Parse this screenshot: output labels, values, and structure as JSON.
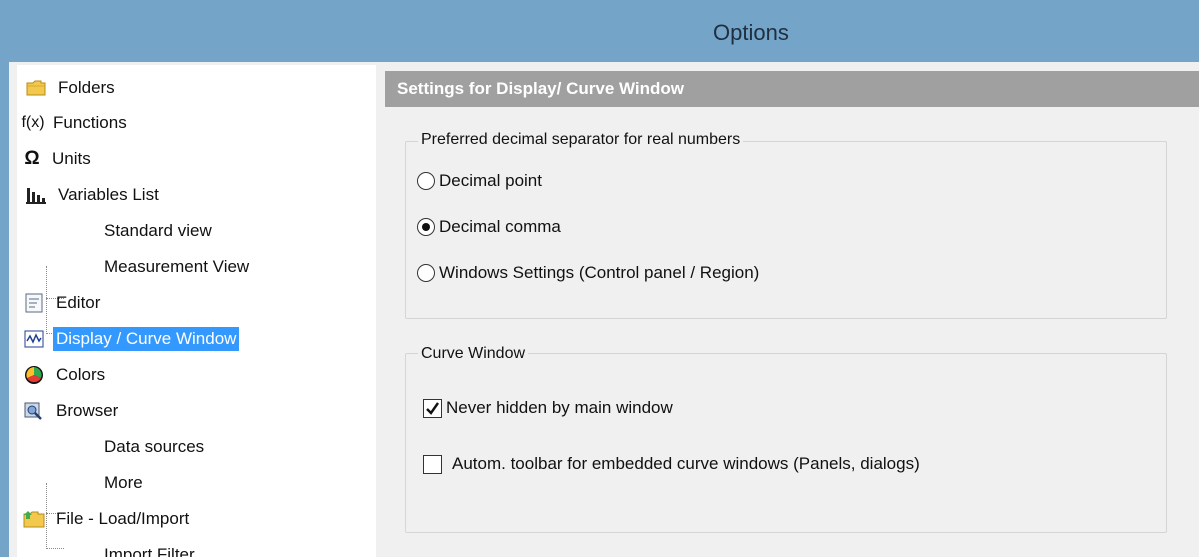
{
  "window": {
    "title": "Options"
  },
  "tree": {
    "items": [
      {
        "label": "Folders",
        "icon": "folder-icon"
      },
      {
        "label": "Functions",
        "icon": "function-icon"
      },
      {
        "label": "Units",
        "icon": "omega-icon"
      },
      {
        "label": "Variables List",
        "icon": "bar-chart-icon"
      },
      {
        "label": "Standard view"
      },
      {
        "label": "Measurement View"
      },
      {
        "label": "Editor",
        "icon": "editor-icon"
      },
      {
        "label": "Display / Curve Window",
        "icon": "curve-icon",
        "selected": true
      },
      {
        "label": "Colors",
        "icon": "colors-icon"
      },
      {
        "label": "Browser",
        "icon": "browser-icon"
      },
      {
        "label": "Data sources"
      },
      {
        "label": "More"
      },
      {
        "label": "File - Load/Import",
        "icon": "file-load-icon"
      },
      {
        "label": "Import Filter"
      }
    ],
    "function_icon_text": "f(x)",
    "omega_icon_text": "Ω"
  },
  "panel": {
    "header": "Settings for Display/ Curve Window",
    "decimal_group": {
      "title": "Preferred decimal separator for real numbers",
      "options": [
        {
          "label": "Decimal point",
          "checked": false
        },
        {
          "label": "Decimal comma",
          "checked": true
        },
        {
          "label": "Windows Settings (Control panel / Region)",
          "checked": false
        }
      ]
    },
    "curve_group": {
      "title": "Curve Window",
      "options": [
        {
          "label": "Never hidden by main window",
          "checked": true
        },
        {
          "label": "Autom. toolbar for embedded curve windows (Panels, dialogs)",
          "checked": false
        }
      ]
    }
  },
  "colors": {
    "titlebar": "#74a4c8",
    "selection": "#3399ff",
    "panel_header": "#a0a0a0"
  }
}
